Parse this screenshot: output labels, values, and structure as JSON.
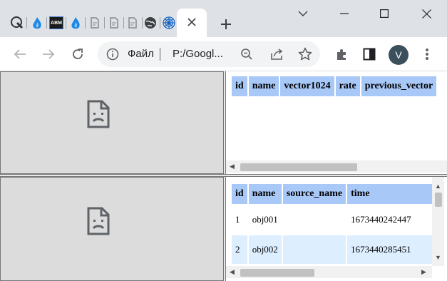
{
  "browser": {
    "tabs": [
      {
        "icon": "globe-wrench-icon"
      },
      {
        "icon": "blue-flame-icon"
      },
      {
        "icon": "abm-logo-icon",
        "label": "ABM"
      },
      {
        "icon": "blue-flame-icon"
      },
      {
        "icon": "blank-page-icon"
      },
      {
        "icon": "blank-page-icon"
      },
      {
        "icon": "blank-page-icon"
      },
      {
        "icon": "globe-icon"
      },
      {
        "icon": "spider-web-icon"
      }
    ],
    "active_tab": {
      "close_icon": "close-icon"
    },
    "new_tab_icon": "plus-icon",
    "window_controls": [
      "chevron-down-icon",
      "minimize-icon",
      "maximize-icon",
      "close-icon"
    ]
  },
  "toolbar": {
    "back_icon": "back-arrow-icon",
    "forward_icon": "forward-arrow-icon",
    "reload_icon": "reload-icon",
    "site_info_icon": "info-icon",
    "scheme_label": "Файл",
    "url": "P:/Googl...",
    "zoom_icon": "zoom-out-icon",
    "share_icon": "share-icon",
    "bookmark_icon": "star-icon",
    "extensions_icon": "puzzle-icon",
    "sidepanel_icon": "side-panel-icon",
    "avatar_letter": "V",
    "menu_icon": "kebab-menu-icon"
  },
  "frames": {
    "top_left": {
      "state": "sad-page-icon"
    },
    "bottom_left": {
      "state": "sad-page-icon"
    },
    "top_right": {
      "columns": [
        "id",
        "name",
        "vector1024",
        "rate",
        "previous_vector"
      ],
      "rows": []
    },
    "bottom_right": {
      "columns": [
        "id",
        "name",
        "source_name",
        "time"
      ],
      "rows": [
        [
          "1",
          "obj001",
          "",
          "1673440242447"
        ],
        [
          "2",
          "obj002",
          "",
          "1673440285451"
        ]
      ]
    }
  },
  "colors": {
    "tab_strip": "#dee1e6",
    "header_cell": "#a8c8f8",
    "alt_row": "#ddeeff",
    "frame_bg": "#dcdcdc"
  }
}
